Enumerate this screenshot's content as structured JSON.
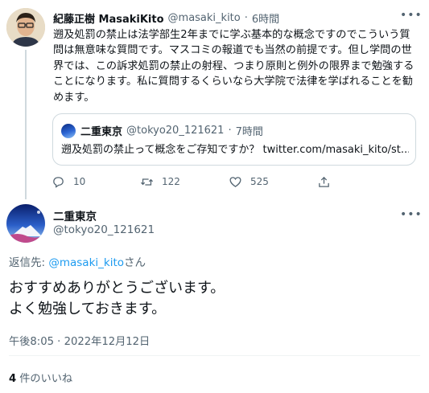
{
  "parent_tweet": {
    "display_name": "紀藤正樹 MasakiKito",
    "handle": "@masaki_kito",
    "separator": "·",
    "time_ago": "6時間",
    "text": "遡及処罰の禁止は法学部生2年までに学ぶ基本的な概念ですのでこういう質問は無意味な質問です。マスコミの報道でも当然の前提です。但し学問の世界では、この訴求処罰の禁止の射程、つまり原則と例外の限界まで勉強することになります。私に質問するくらいなら大学院で法律を学ばれることを勧めます。",
    "quote": {
      "display_name": "二重東京",
      "handle": "@tokyo20_121621",
      "separator": "·",
      "time_ago": "7時間",
      "text": "遡及処罰の禁止って概念をご存知ですか？ twitter.com/masaki_kito/st..."
    },
    "actions": {
      "reply_count": "10",
      "retweet_count": "122",
      "like_count": "525"
    }
  },
  "reply_tweet": {
    "display_name": "二重東京",
    "handle": "@tokyo20_121621",
    "reply_to_prefix": "返信先: ",
    "reply_to_mention": "@masaki_kito",
    "reply_to_suffix": "さん",
    "text_line1": "おすすめありがとうございます。",
    "text_line2": "よく勉強しておきます。",
    "timestamp": "午後8:05 · 2022年12月12日",
    "likes_count": "4",
    "likes_label": "件のいいね"
  },
  "icons": {
    "more": "more-icon",
    "reply": "reply-icon",
    "retweet": "retweet-icon",
    "like": "heart-icon",
    "share": "share-icon"
  },
  "colors": {
    "link": "#1d9bf0",
    "secondary_text": "#536471",
    "border": "#cfd9de"
  }
}
